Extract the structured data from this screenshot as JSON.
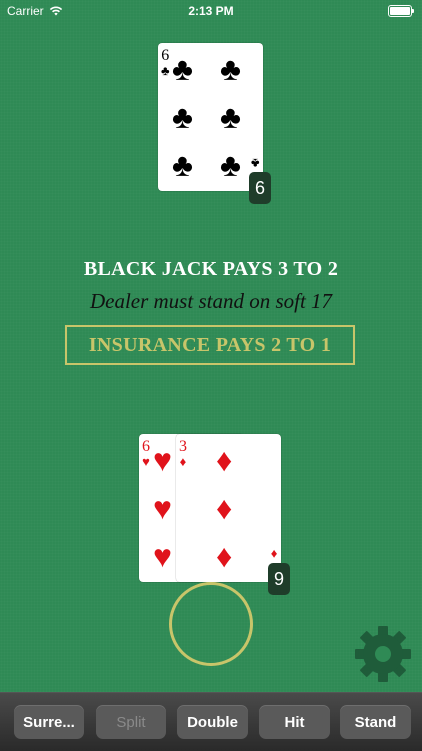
{
  "status_bar": {
    "carrier": "Carrier",
    "time": "2:13 PM"
  },
  "dealer": {
    "card": {
      "rank": "6",
      "suit": "♣"
    },
    "count": "6"
  },
  "table": {
    "line1": "BLACK JACK PAYS 3 TO 2",
    "line2": "Dealer must stand on soft 17",
    "insurance": "INSURANCE PAYS 2 TO 1"
  },
  "player": {
    "cards": [
      {
        "rank": "6",
        "suit": "♥"
      },
      {
        "rank": "3",
        "suit": "♦"
      }
    ],
    "count": "9"
  },
  "toolbar": {
    "surrender": "Surre...",
    "split": "Split",
    "double": "Double",
    "hit": "Hit",
    "stand": "Stand"
  },
  "colors": {
    "felt": "#2f8a55",
    "gold": "#c8c56a",
    "red_suit": "#e0131b"
  },
  "icons": {
    "settings": "gear-icon",
    "wifi": "wifi-icon",
    "battery": "battery-icon"
  }
}
